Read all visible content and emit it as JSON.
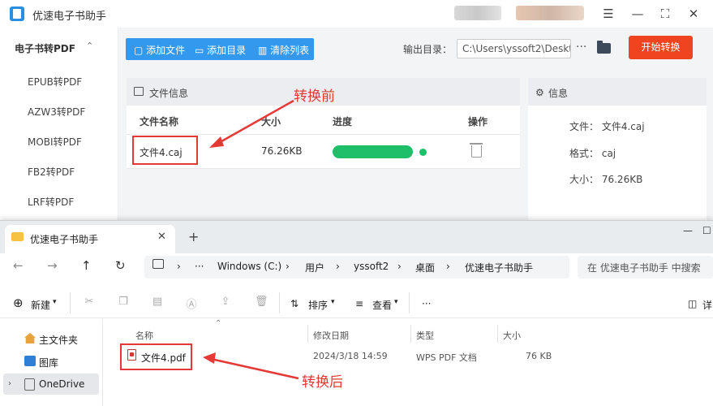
{
  "app": {
    "title": "优速电子书助手",
    "controls": {
      "menu": "☰",
      "minimize": "—",
      "maximize": "⛶",
      "close": "✕"
    }
  },
  "sidebar": {
    "group": "电子书转PDF",
    "chevron": "⌃",
    "items": [
      "EPUB转PDF",
      "AZW3转PDF",
      "MOBI转PDF",
      "FB2转PDF",
      "LRF转PDF"
    ]
  },
  "toolbar": {
    "add_file": "添加文件",
    "add_dir": "添加目录",
    "clear_list": "清除列表",
    "output_label": "输出目录：",
    "output_path": "C:\\Users\\yssoft2\\Deskto",
    "more": "···",
    "start": "开始转换"
  },
  "file_panel": {
    "title": "文件信息",
    "columns": {
      "name": "文件名称",
      "size": "大小",
      "progress": "进度",
      "action": "操作"
    },
    "row": {
      "name": "文件4.caj",
      "size": "76.26KB",
      "progress": 1.0
    }
  },
  "info_panel": {
    "title": "信息",
    "rows": [
      {
        "label": "文件：",
        "value": "文件4.caj"
      },
      {
        "label": "格式：",
        "value": "caj"
      },
      {
        "label": "大小：",
        "value": "76.26KB"
      }
    ]
  },
  "annotations": {
    "before": "转换前",
    "after": "转换后"
  },
  "colors": {
    "accent": "#3399ee",
    "start": "#f0431f",
    "progress": "#1fbf6a",
    "annotation": "#e53935"
  },
  "explorer": {
    "tab_label": "优速电子书助手",
    "tab_close": "✕",
    "tab_add": "+",
    "win_controls": {
      "minimize": "—",
      "maximize": "☐"
    },
    "nav": {
      "back": "←",
      "forward": "→",
      "up": "↑",
      "refresh": "↻"
    },
    "breadcrumb": [
      "Windows (C:)",
      "用户",
      "yssoft2",
      "桌面",
      "优速电子书助手"
    ],
    "breadcrumb_sep": "›",
    "breadcrumb_more": "···",
    "search_placeholder": "在 优速电子书助手 中搜索",
    "commands": {
      "new": "新建",
      "sort": "排序",
      "view": "查看",
      "more": "···",
      "details": "详"
    },
    "nav_pane": [
      "主文件夹",
      "图库",
      "OneDrive"
    ],
    "list_columns": {
      "name": "名称",
      "modified": "修改日期",
      "type": "类型",
      "size": "大小"
    },
    "file": {
      "name": "文件4.pdf",
      "modified": "2024/3/18 14:59",
      "type": "WPS PDF 文档",
      "size": "76 KB"
    }
  }
}
